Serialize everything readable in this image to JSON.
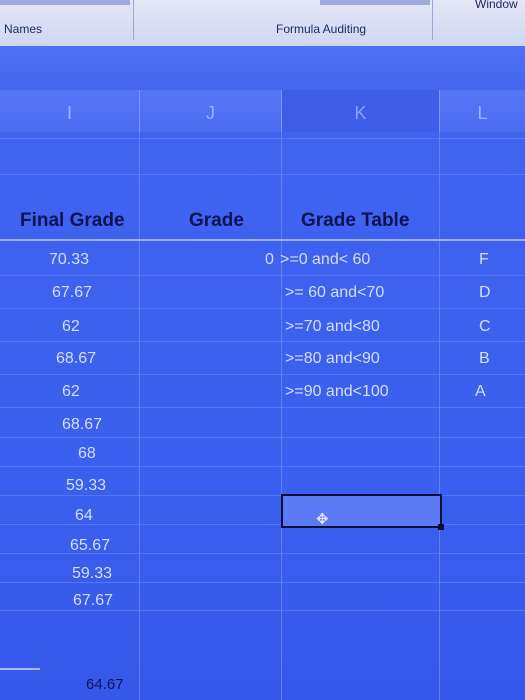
{
  "ribbon": {
    "names_label": "Names",
    "formula_auditing_label": "Formula Auditing",
    "window_label": "Window"
  },
  "columns": [
    "I",
    "J",
    "K",
    "L"
  ],
  "headers": {
    "final_grade": "Final Grade",
    "grade": "Grade",
    "grade_table": "Grade Table"
  },
  "final_grades": [
    "70.33",
    "67.67",
    "62",
    "68.67",
    "62",
    "68.67",
    "68",
    "59.33",
    "64",
    "65.67",
    "59.33",
    "67.67",
    "64.67"
  ],
  "grade_table": [
    {
      "min": "0",
      "range": ">=0 and< 60",
      "letter": "F"
    },
    {
      "min": "",
      "range": ">= 60 and<70",
      "letter": "D"
    },
    {
      "min": "",
      "range": ">=70 and<80",
      "letter": "C"
    },
    {
      "min": "",
      "range": ">=80 and<90",
      "letter": "B"
    },
    {
      "min": "",
      "range": ">=90 and<100",
      "letter": "A"
    }
  ],
  "colors": {
    "sheet_blue": "#3f63ee",
    "text_dark": "#0d1450"
  }
}
